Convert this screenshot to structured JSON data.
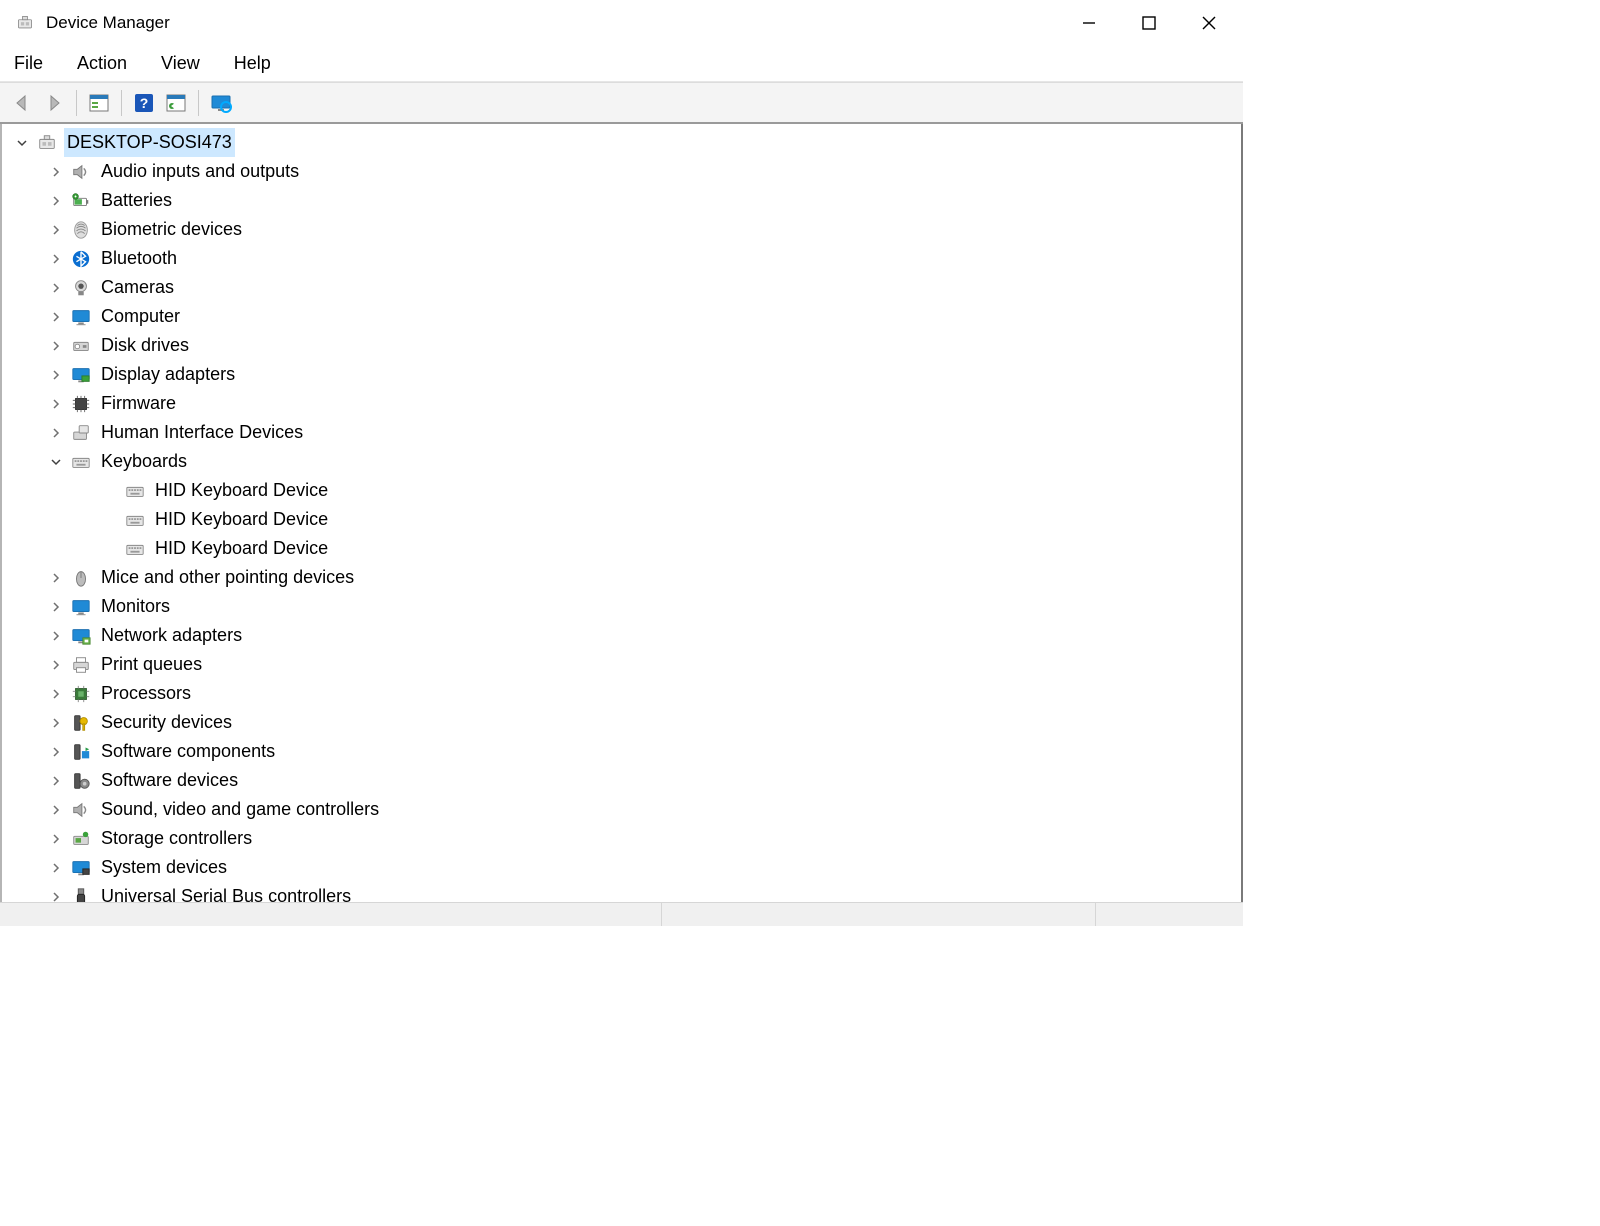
{
  "window": {
    "title": "Device Manager"
  },
  "menu": {
    "file": "File",
    "action": "Action",
    "view": "View",
    "help": "Help"
  },
  "toolbar": {
    "back": "Back",
    "forward": "Forward",
    "properties": "Properties",
    "help": "Help",
    "scan": "Scan for hardware changes",
    "monitor": "Add legacy hardware"
  },
  "tree": {
    "root": {
      "label": "DESKTOP-SOSI473",
      "icon": "computer"
    },
    "items": [
      {
        "label": "Audio inputs and outputs",
        "icon": "speaker"
      },
      {
        "label": "Batteries",
        "icon": "battery"
      },
      {
        "label": "Biometric devices",
        "icon": "fingerprint"
      },
      {
        "label": "Bluetooth",
        "icon": "bluetooth"
      },
      {
        "label": "Cameras",
        "icon": "camera"
      },
      {
        "label": "Computer",
        "icon": "monitor"
      },
      {
        "label": "Disk drives",
        "icon": "disk"
      },
      {
        "label": "Display adapters",
        "icon": "display-adapter"
      },
      {
        "label": "Firmware",
        "icon": "chip"
      },
      {
        "label": "Human Interface Devices",
        "icon": "hid"
      },
      {
        "label": "Keyboards",
        "icon": "keyboard",
        "expanded": true,
        "children": [
          {
            "label": "HID Keyboard Device",
            "icon": "keyboard"
          },
          {
            "label": "HID Keyboard Device",
            "icon": "keyboard"
          },
          {
            "label": "HID Keyboard Device",
            "icon": "keyboard"
          }
        ]
      },
      {
        "label": "Mice and other pointing devices",
        "icon": "mouse"
      },
      {
        "label": "Monitors",
        "icon": "monitor"
      },
      {
        "label": "Network adapters",
        "icon": "network"
      },
      {
        "label": "Print queues",
        "icon": "printer"
      },
      {
        "label": "Processors",
        "icon": "cpu"
      },
      {
        "label": "Security devices",
        "icon": "security"
      },
      {
        "label": "Software components",
        "icon": "software-component"
      },
      {
        "label": "Software devices",
        "icon": "software-device"
      },
      {
        "label": "Sound, video and game controllers",
        "icon": "speaker"
      },
      {
        "label": "Storage controllers",
        "icon": "storage"
      },
      {
        "label": "System devices",
        "icon": "system"
      },
      {
        "label": "Universal Serial Bus controllers",
        "icon": "usb"
      }
    ]
  }
}
